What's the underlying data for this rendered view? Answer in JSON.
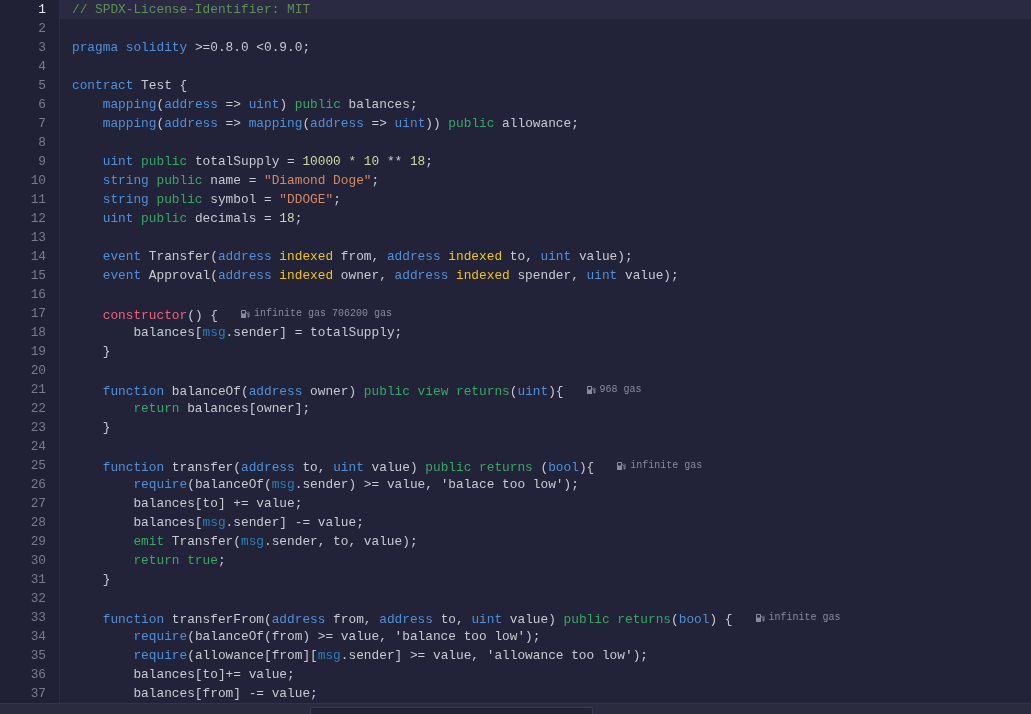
{
  "editor": {
    "lines": [
      {
        "number": "1",
        "active": true,
        "tokens": [
          {
            "kind": "comment",
            "text": "// SPDX-License-Identifier: MIT"
          }
        ]
      },
      {
        "number": "2",
        "active": false
      },
      {
        "number": "3",
        "active": false,
        "tokens": [
          {
            "kind": "keyword",
            "text": "pragma"
          },
          {
            "kind": "keyword",
            "text": " solidity"
          },
          {
            "kind": "plain",
            "text": " >=0.8.0 <0.9.0;"
          }
        ]
      },
      {
        "number": "4",
        "active": false
      },
      {
        "number": "5",
        "active": false,
        "tokens": [
          {
            "kind": "keyword",
            "text": "contract"
          },
          {
            "kind": "plain",
            "text": " Test {"
          }
        ]
      },
      {
        "number": "6",
        "active": false,
        "tokens": [
          {
            "kind": "keyword",
            "text": "    mapping"
          },
          {
            "kind": "plain",
            "text": "("
          },
          {
            "kind": "type",
            "text": "address"
          },
          {
            "kind": "plain",
            "text": " => "
          },
          {
            "kind": "type",
            "text": "uint"
          },
          {
            "kind": "plain",
            "text": ") "
          },
          {
            "kind": "modifier",
            "text": "public"
          },
          {
            "kind": "plain",
            "text": " balances;"
          }
        ]
      },
      {
        "number": "7",
        "active": false,
        "tokens": [
          {
            "kind": "keyword",
            "text": "    mapping"
          },
          {
            "kind": "plain",
            "text": "("
          },
          {
            "kind": "type",
            "text": "address"
          },
          {
            "kind": "plain",
            "text": " => "
          },
          {
            "kind": "keyword",
            "text": "mapping"
          },
          {
            "kind": "plain",
            "text": "("
          },
          {
            "kind": "type",
            "text": "address"
          },
          {
            "kind": "plain",
            "text": " => "
          },
          {
            "kind": "type",
            "text": "uint"
          },
          {
            "kind": "plain",
            "text": ")) "
          },
          {
            "kind": "modifier",
            "text": "public"
          },
          {
            "kind": "plain",
            "text": " allowance;"
          }
        ]
      },
      {
        "number": "8",
        "active": false
      },
      {
        "number": "9",
        "active": false,
        "tokens": [
          {
            "kind": "type",
            "text": "    uint"
          },
          {
            "kind": "modifier",
            "text": " public"
          },
          {
            "kind": "plain",
            "text": " totalSupply = "
          },
          {
            "kind": "number",
            "text": "10000"
          },
          {
            "kind": "plain",
            "text": " * "
          },
          {
            "kind": "number",
            "text": "10"
          },
          {
            "kind": "plain",
            "text": " ** "
          },
          {
            "kind": "number",
            "text": "18"
          },
          {
            "kind": "plain",
            "text": ";"
          }
        ]
      },
      {
        "number": "10",
        "active": false,
        "tokens": [
          {
            "kind": "type",
            "text": "    string"
          },
          {
            "kind": "modifier",
            "text": " public"
          },
          {
            "kind": "plain",
            "text": " name = "
          },
          {
            "kind": "string",
            "text": "\"Diamond Doge\""
          },
          {
            "kind": "plain",
            "text": ";"
          }
        ]
      },
      {
        "number": "11",
        "active": false,
        "tokens": [
          {
            "kind": "type",
            "text": "    string"
          },
          {
            "kind": "modifier",
            "text": " public"
          },
          {
            "kind": "plain",
            "text": " symbol = "
          },
          {
            "kind": "string",
            "text": "\"DDOGE\""
          },
          {
            "kind": "plain",
            "text": ";"
          }
        ]
      },
      {
        "number": "12",
        "active": false,
        "tokens": [
          {
            "kind": "type",
            "text": "    uint"
          },
          {
            "kind": "modifier",
            "text": " public"
          },
          {
            "kind": "plain",
            "text": " decimals = "
          },
          {
            "kind": "number",
            "text": "18"
          },
          {
            "kind": "plain",
            "text": ";"
          }
        ]
      },
      {
        "number": "13",
        "active": false
      },
      {
        "number": "14",
        "active": false,
        "tokens": [
          {
            "kind": "keyword",
            "text": "    event"
          },
          {
            "kind": "plain",
            "text": " Transfer("
          },
          {
            "kind": "type",
            "text": "address"
          },
          {
            "kind": "indexed",
            "text": " indexed"
          },
          {
            "kind": "plain",
            "text": " from, "
          },
          {
            "kind": "type",
            "text": "address"
          },
          {
            "kind": "indexed",
            "text": " indexed"
          },
          {
            "kind": "plain",
            "text": " to, "
          },
          {
            "kind": "type",
            "text": "uint"
          },
          {
            "kind": "plain",
            "text": " value);"
          }
        ]
      },
      {
        "number": "15",
        "active": false,
        "tokens": [
          {
            "kind": "keyword",
            "text": "    event"
          },
          {
            "kind": "plain",
            "text": " Approval("
          },
          {
            "kind": "type",
            "text": "address"
          },
          {
            "kind": "indexed",
            "text": " indexed"
          },
          {
            "kind": "plain",
            "text": " owner, "
          },
          {
            "kind": "type",
            "text": "address"
          },
          {
            "kind": "indexed",
            "text": " indexed"
          },
          {
            "kind": "plain",
            "text": " spender, "
          },
          {
            "kind": "type",
            "text": "uint"
          },
          {
            "kind": "plain",
            "text": " value);"
          }
        ]
      },
      {
        "number": "16",
        "active": false
      },
      {
        "number": "17",
        "active": false,
        "tokens": [
          {
            "kind": "constructor",
            "text": "    constructor"
          },
          {
            "kind": "plain",
            "text": "() {"
          }
        ],
        "hint": "infinite gas 706200 gas"
      },
      {
        "number": "18",
        "active": false,
        "tokens": [
          {
            "kind": "plain",
            "text": "        balances["
          },
          {
            "kind": "builtin",
            "text": "msg"
          },
          {
            "kind": "plain",
            "text": ".sender] = totalSupply;"
          }
        ]
      },
      {
        "number": "19",
        "active": false,
        "tokens": [
          {
            "kind": "plain",
            "text": "    }"
          }
        ]
      },
      {
        "number": "20",
        "active": false
      },
      {
        "number": "21",
        "active": false,
        "tokens": [
          {
            "kind": "keyword",
            "text": "    function"
          },
          {
            "kind": "plain",
            "text": " balanceOf("
          },
          {
            "kind": "type",
            "text": "address"
          },
          {
            "kind": "plain",
            "text": " owner) "
          },
          {
            "kind": "modifier",
            "text": "public"
          },
          {
            "kind": "modifier",
            "text": " view"
          },
          {
            "kind": "modifier",
            "text": " returns"
          },
          {
            "kind": "plain",
            "text": "("
          },
          {
            "kind": "type",
            "text": "uint"
          },
          {
            "kind": "plain",
            "text": "){"
          }
        ],
        "hint": "968 gas"
      },
      {
        "number": "22",
        "active": false,
        "tokens": [
          {
            "kind": "control",
            "text": "        return"
          },
          {
            "kind": "plain",
            "text": " balances[owner];"
          }
        ]
      },
      {
        "number": "23",
        "active": false,
        "tokens": [
          {
            "kind": "plain",
            "text": "    }"
          }
        ]
      },
      {
        "number": "24",
        "active": false
      },
      {
        "number": "25",
        "active": false,
        "tokens": [
          {
            "kind": "keyword",
            "text": "    function"
          },
          {
            "kind": "plain",
            "text": " transfer("
          },
          {
            "kind": "type",
            "text": "address"
          },
          {
            "kind": "plain",
            "text": " to, "
          },
          {
            "kind": "type",
            "text": "uint"
          },
          {
            "kind": "plain",
            "text": " value) "
          },
          {
            "kind": "modifier",
            "text": "public"
          },
          {
            "kind": "modifier",
            "text": " returns"
          },
          {
            "kind": "plain",
            "text": " ("
          },
          {
            "kind": "type",
            "text": "bool"
          },
          {
            "kind": "plain",
            "text": "){"
          }
        ],
        "hint": "infinite gas"
      },
      {
        "number": "26",
        "active": false,
        "tokens": [
          {
            "kind": "keyword",
            "text": "        require"
          },
          {
            "kind": "plain",
            "text": "(balanceOf("
          },
          {
            "kind": "builtin",
            "text": "msg"
          },
          {
            "kind": "plain",
            "text": ".sender) >= value, 'balace too low');"
          }
        ]
      },
      {
        "number": "27",
        "active": false,
        "tokens": [
          {
            "kind": "plain",
            "text": "        balances[to] += value;"
          }
        ]
      },
      {
        "number": "28",
        "active": false,
        "tokens": [
          {
            "kind": "plain",
            "text": "        balances["
          },
          {
            "kind": "builtin",
            "text": "msg"
          },
          {
            "kind": "plain",
            "text": ".sender] -= value;"
          }
        ]
      },
      {
        "number": "29",
        "active": false,
        "tokens": [
          {
            "kind": "control",
            "text": "        emit"
          },
          {
            "kind": "plain",
            "text": " Transfer("
          },
          {
            "kind": "builtin",
            "text": "msg"
          },
          {
            "kind": "plain",
            "text": ".sender, to, value);"
          }
        ]
      },
      {
        "number": "30",
        "active": false,
        "tokens": [
          {
            "kind": "control",
            "text": "        return"
          },
          {
            "kind": "control",
            "text": " true"
          },
          {
            "kind": "plain",
            "text": ";"
          }
        ]
      },
      {
        "number": "31",
        "active": false,
        "tokens": [
          {
            "kind": "plain",
            "text": "    }"
          }
        ]
      },
      {
        "number": "32",
        "active": false
      },
      {
        "number": "33",
        "active": false,
        "tokens": [
          {
            "kind": "keyword",
            "text": "    function"
          },
          {
            "kind": "plain",
            "text": " transferFrom("
          },
          {
            "kind": "type",
            "text": "address"
          },
          {
            "kind": "plain",
            "text": " from, "
          },
          {
            "kind": "type",
            "text": "address"
          },
          {
            "kind": "plain",
            "text": " to, "
          },
          {
            "kind": "type",
            "text": "uint"
          },
          {
            "kind": "plain",
            "text": " value) "
          },
          {
            "kind": "modifier",
            "text": "public"
          },
          {
            "kind": "modifier",
            "text": " returns"
          },
          {
            "kind": "plain",
            "text": "("
          },
          {
            "kind": "type",
            "text": "bool"
          },
          {
            "kind": "plain",
            "text": ") {"
          }
        ],
        "hint": "infinite gas"
      },
      {
        "number": "34",
        "active": false,
        "tokens": [
          {
            "kind": "keyword",
            "text": "        require"
          },
          {
            "kind": "plain",
            "text": "(balanceOf(from) >= value, 'balance too low');"
          }
        ]
      },
      {
        "number": "35",
        "active": false,
        "tokens": [
          {
            "kind": "keyword",
            "text": "        require"
          },
          {
            "kind": "plain",
            "text": "(allowance[from]["
          },
          {
            "kind": "builtin",
            "text": "msg"
          },
          {
            "kind": "plain",
            "text": ".sender] >= value, 'allowance too low');"
          }
        ]
      },
      {
        "number": "36",
        "active": false,
        "tokens": [
          {
            "kind": "plain",
            "text": "        balances[to]+= value;"
          }
        ]
      },
      {
        "number": "37",
        "active": false,
        "tokens": [
          {
            "kind": "plain",
            "text": "        balances[from] -= value;"
          }
        ]
      }
    ]
  }
}
